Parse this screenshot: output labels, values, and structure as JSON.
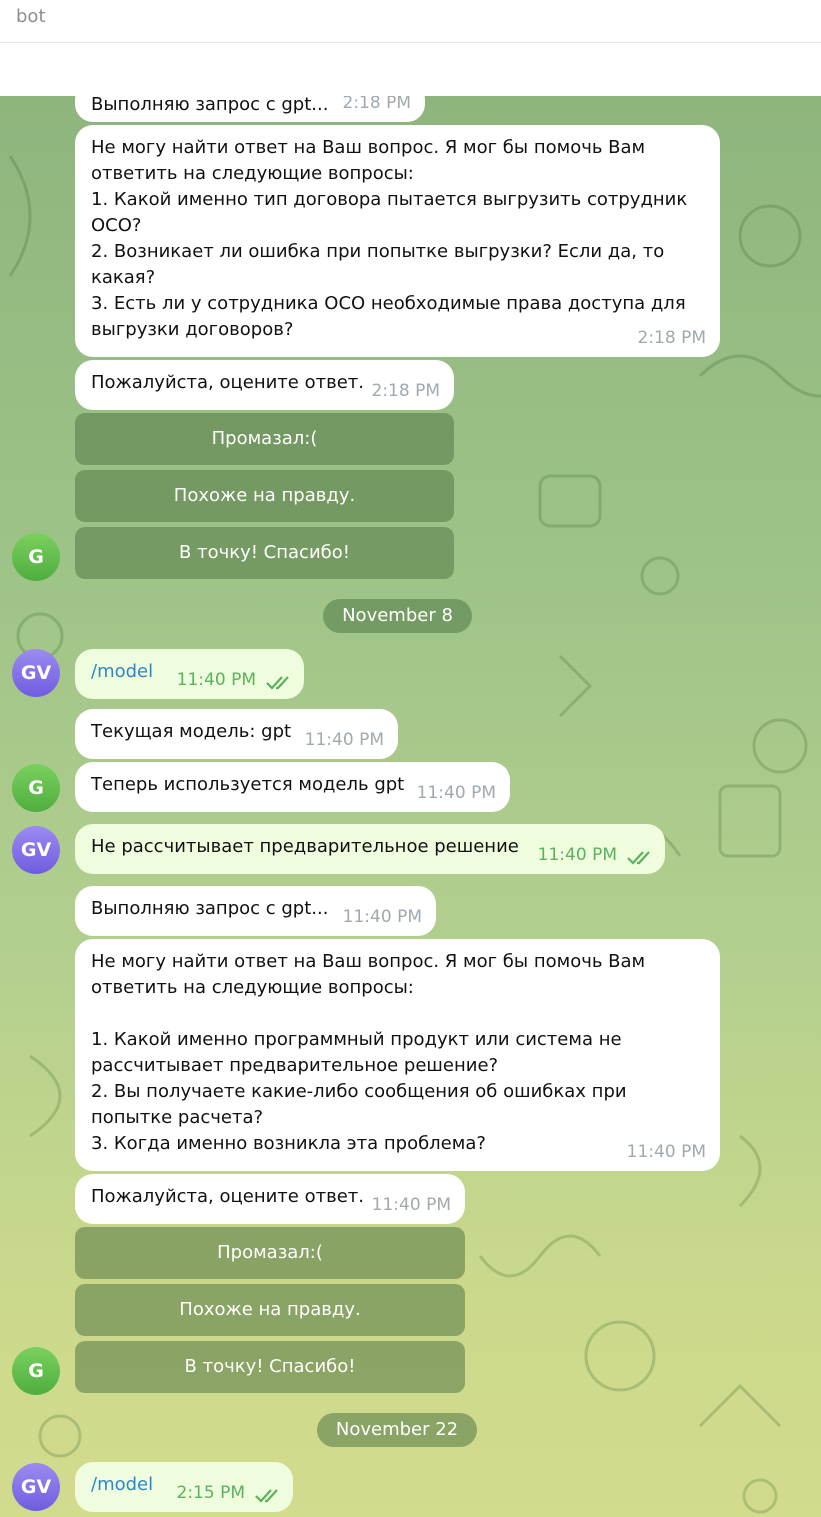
{
  "header": {
    "title": "bot"
  },
  "messages": {
    "m1": {
      "text": "Выполняю запрос с gpt...",
      "time": "2:18 PM"
    },
    "m2": {
      "text": "Не могу найти ответ на Ваш вопрос. Я мог бы помочь Вам ответить на следующие вопросы:\n1. Какой именно тип договора пытается выгрузить сотрудник ОСО?\n2. Возникает ли ошибка при попытке выгрузки? Если да, то какая?\n3. Есть ли у сотрудника ОСО необходимые права доступа для выгрузки договоров?",
      "time": "2:18 PM"
    },
    "m3": {
      "text": "Пожалуйста, оцените ответ.",
      "time": "2:18 PM"
    },
    "kb1": [
      "Промазал:(",
      "Похоже на правду.",
      "В точку! Спасибо!"
    ],
    "date1": "November 8",
    "m4": {
      "text": "/model",
      "time": "11:40 PM"
    },
    "m5": {
      "text": "Текущая модель: gpt",
      "time": "11:40 PM"
    },
    "m6": {
      "text": "Теперь используется модель gpt",
      "time": "11:40 PM"
    },
    "m7": {
      "text": "Не рассчитывает предварительное решение",
      "time": "11:40 PM"
    },
    "m8": {
      "text": "Выполняю запрос с gpt...",
      "time": "11:40 PM"
    },
    "m9": {
      "text": "Не могу найти ответ на Ваш вопрос. Я мог бы помочь Вам ответить на следующие вопросы:\n\n1. Какой именно программный продукт или система не рассчитывает предварительное решение?\n2. Вы получаете какие-либо сообщения об ошибках при попытке расчета?\n3. Когда именно возникла эта проблема?",
      "time": "11:40 PM"
    },
    "m10": {
      "text": "Пожалуйста, оцените ответ.",
      "time": "11:40 PM"
    },
    "kb2": [
      "Промазал:(",
      "Похоже на правду.",
      "В точку! Спасибо!"
    ],
    "date2": "November 22",
    "m11": {
      "text": "/model",
      "time": "2:15 PM"
    }
  },
  "avatars": {
    "bot": "G",
    "user": "GV"
  },
  "colors": {
    "outgoing": "#effdde",
    "incoming": "#ffffff",
    "check": "#5ab35c",
    "link": "#2e86c9"
  }
}
